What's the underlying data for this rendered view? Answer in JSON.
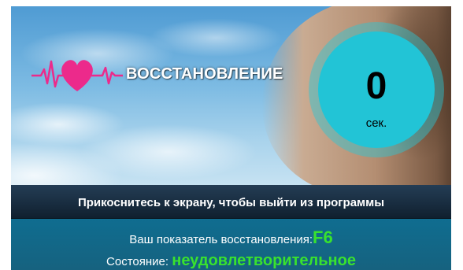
{
  "header": {
    "title": "ВОССТАНОВЛЕНИЕ",
    "logo_icon": "heart-pulse-icon"
  },
  "timer": {
    "value": "0",
    "unit": "сек."
  },
  "banner": {
    "instruction": "Прикоснитесь к экрану, чтобы выйти из программы"
  },
  "results": {
    "score_label": "Ваш показатель восстановления:",
    "score_value": "F6",
    "state_label": "Состояние:",
    "state_value": "неудовлетворительное"
  },
  "colors": {
    "accent": "#22c4d6",
    "heart": "#ec2a8b",
    "result_value": "#39e22e",
    "banner": "#1a2f44"
  }
}
